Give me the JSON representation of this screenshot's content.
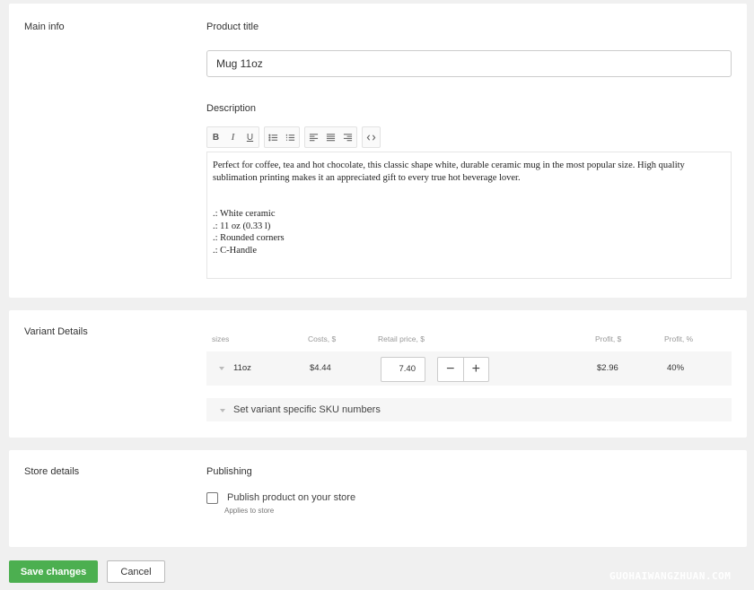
{
  "main_info": {
    "section_label": "Main info",
    "product_title_label": "Product title",
    "product_title_value": "Mug 11oz",
    "description_label": "Description",
    "toolbar": {
      "bold": "B",
      "italic": "I",
      "underline": "U",
      "icons": [
        "bullet-list-icon",
        "numbered-list-icon",
        "align-left-icon",
        "align-center-icon",
        "align-right-icon",
        "code-icon"
      ]
    },
    "description": {
      "paragraph": "Perfect for coffee, tea and hot chocolate, this classic shape white, durable ceramic mug in the most popular size. High quality sublimation printing makes it an appreciated gift to every true hot beverage lover.",
      "bullets": [
        ".: White ceramic",
        ".: 11 oz (0.33 l)",
        ".: Rounded corners",
        ".: C-Handle"
      ]
    }
  },
  "variant_details": {
    "section_label": "Variant Details",
    "headers": {
      "sizes": "sizes",
      "costs": "Costs, $",
      "retail": "Retail price, $",
      "profit": "Profit, $",
      "profit_pct": "Profit, %"
    },
    "row": {
      "size": "11oz",
      "cost": "$4.44",
      "retail_price": "7.40",
      "profit": "$2.96",
      "profit_pct": "40%"
    },
    "stepper": {
      "minus": "−",
      "plus": "+"
    },
    "sku_toggle": "Set variant specific SKU numbers"
  },
  "store_details": {
    "section_label": "Store details",
    "publishing_label": "Publishing",
    "publish_checkbox_label": "Publish product on your store",
    "publish_checkbox_checked": false,
    "publish_sub": "Applies to store"
  },
  "footer": {
    "save": "Save changes",
    "cancel": "Cancel"
  },
  "watermark": "GUOHAIWANGZHUAN.COM",
  "colors": {
    "accent": "#4caf50",
    "background": "#f0f0f0"
  }
}
